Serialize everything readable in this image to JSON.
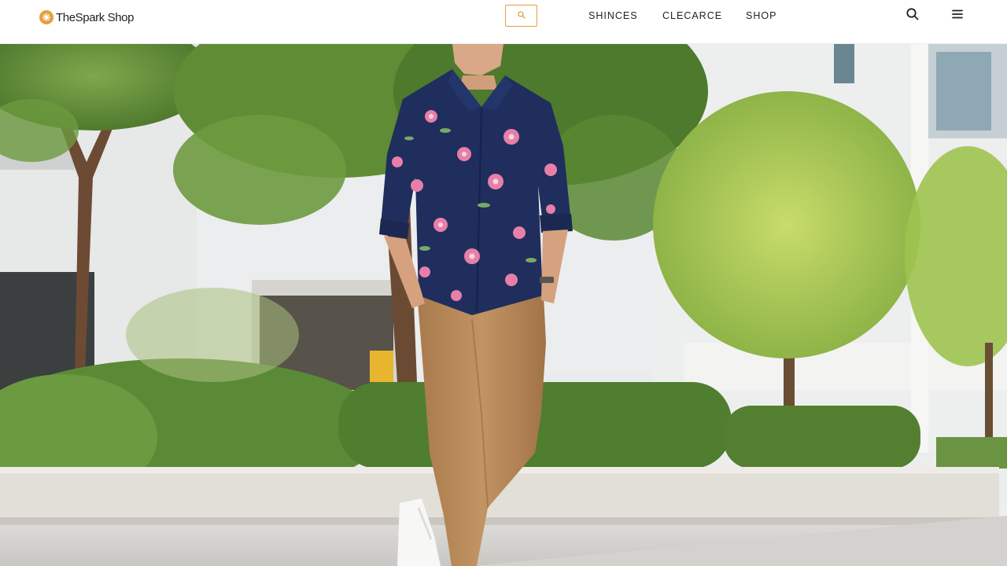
{
  "brand": {
    "name": "TheSpark Shop",
    "accent": "#e3a03c"
  },
  "header": {
    "search_field_icon": "search-icon",
    "nav": [
      {
        "label": "SHINCES"
      },
      {
        "label": "CLECARCE"
      },
      {
        "label": "SHOP"
      }
    ],
    "right_icons": [
      "search-icon",
      "hamburger-menu-icon"
    ]
  },
  "hero": {
    "image_subject": "model-floral-shirt-khaki-pants",
    "colors": {
      "shirt": "#1f2e5c",
      "pants": "#b98a5a",
      "foliage": "#6f9a3e",
      "building": "#e8e9ea"
    }
  }
}
